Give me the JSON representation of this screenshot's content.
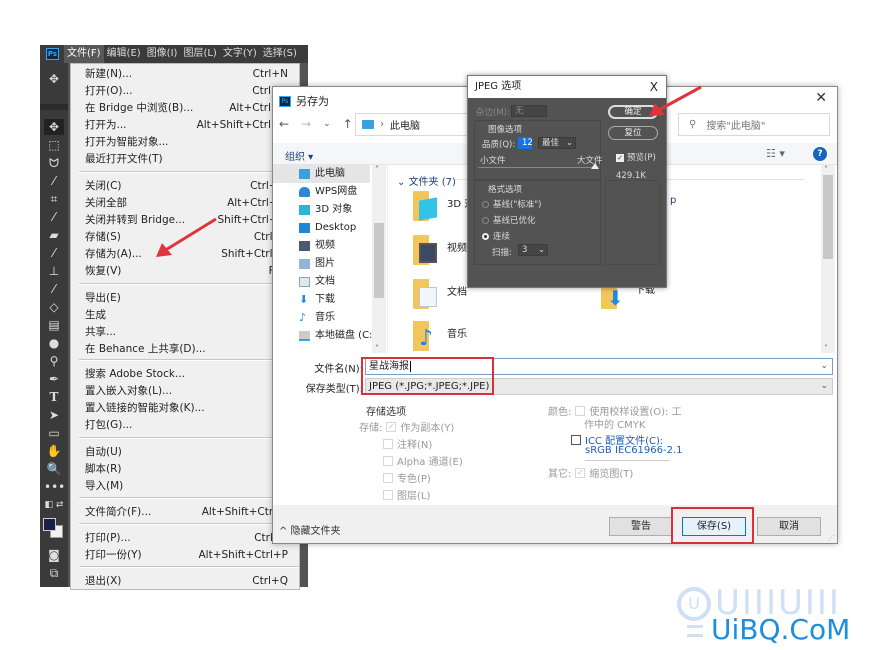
{
  "photoshop": {
    "menubar": [
      {
        "label": "文件(F)",
        "active": true
      },
      {
        "label": "编辑(E)"
      },
      {
        "label": "图像(I)"
      },
      {
        "label": "图层(L)"
      },
      {
        "label": "文字(Y)"
      },
      {
        "label": "选择(S)"
      }
    ],
    "logo": "Ps",
    "tools": [
      "move-tool",
      "marquee-tool",
      "lasso-tool",
      "magic-wand-tool",
      "crop-tool",
      "eyedropper-tool",
      "healing-brush-tool",
      "brush-tool",
      "clone-stamp-tool",
      "history-brush-tool",
      "eraser-tool",
      "gradient-tool",
      "blur-tool",
      "dodge-tool",
      "pen-tool",
      "type-tool",
      "path-selection-tool",
      "rectangle-tool",
      "hand-tool",
      "zoom-tool",
      "more-tools"
    ],
    "file_menu": [
      {
        "label": "新建(N)...",
        "shortcut": "Ctrl+N"
      },
      {
        "label": "打开(O)...",
        "shortcut": "Ctrl+O"
      },
      {
        "label": "在 Bridge 中浏览(B)...",
        "shortcut": "Alt+Ctrl+O"
      },
      {
        "label": "打开为...",
        "shortcut": "Alt+Shift+Ctrl+O"
      },
      {
        "label": "打开为智能对象...",
        "shortcut": ""
      },
      {
        "label": "最近打开文件(T)",
        "shortcut": ""
      },
      {
        "label": "关闭(C)",
        "shortcut": "Ctrl+W"
      },
      {
        "label": "关闭全部",
        "shortcut": "Alt+Ctrl+W"
      },
      {
        "label": "关闭并转到 Bridge...",
        "shortcut": "Shift+Ctrl+W"
      },
      {
        "label": "存储(S)",
        "shortcut": "Ctrl+S"
      },
      {
        "label": "存储为(A)...",
        "shortcut": "Shift+Ctrl+S"
      },
      {
        "label": "恢复(V)",
        "shortcut": "F12"
      },
      {
        "label": "导出(E)",
        "shortcut": ""
      },
      {
        "label": "生成",
        "shortcut": ""
      },
      {
        "label": "共享...",
        "shortcut": ""
      },
      {
        "label": "在 Behance 上共享(D)...",
        "shortcut": ""
      },
      {
        "label": "搜索 Adobe Stock...",
        "shortcut": ""
      },
      {
        "label": "置入嵌入对象(L)...",
        "shortcut": ""
      },
      {
        "label": "置入链接的智能对象(K)...",
        "shortcut": ""
      },
      {
        "label": "打包(G)...",
        "shortcut": ""
      },
      {
        "label": "自动(U)",
        "shortcut": ""
      },
      {
        "label": "脚本(R)",
        "shortcut": ""
      },
      {
        "label": "导入(M)",
        "shortcut": ""
      },
      {
        "label": "文件简介(F)...",
        "shortcut": "Alt+Shift+Ctrl+I"
      },
      {
        "label": "打印(P)...",
        "shortcut": "Ctrl+P"
      },
      {
        "label": "打印一份(Y)",
        "shortcut": "Alt+Shift+Ctrl+P"
      },
      {
        "label": "退出(X)",
        "shortcut": "Ctrl+Q"
      }
    ],
    "fg_color": "#1a1f4a",
    "bg_color": "#f2f2f2"
  },
  "save_as": {
    "title": "另存为",
    "close": "✕",
    "address": "此电脑",
    "search_placeholder": "搜索\"此电脑\"",
    "organize": "组织 ▾",
    "help": "?",
    "nav_items": [
      "此电脑",
      "WPS网盘",
      "3D 对象",
      "Desktop",
      "视频",
      "图片",
      "文档",
      "下载",
      "音乐",
      "本地磁盘 (C:)"
    ],
    "group_header": "文件夹 (7)",
    "folders": [
      "3D 对象",
      "视频",
      "文档",
      "音乐",
      "Desktop",
      "下载"
    ],
    "filename_label": "文件名(N):",
    "filename_value": "星战海报",
    "filetype_label": "保存类型(T):",
    "filetype_value": "JPEG (*.JPG;*.JPEG;*.JPE)",
    "options": {
      "header": "存储选项",
      "save_label": "存储:",
      "as_copy": "作为副本(Y)",
      "notes": "注释(N)",
      "alpha": "Alpha 通道(E)",
      "spot": "专色(P)",
      "layers": "图层(L)",
      "color_label": "颜色:",
      "proof": "使用校样设置(O): 工",
      "proof2": "作中的 CMYK",
      "icc": "ICC 配置文件(C):",
      "icc2": "sRGB IEC61966-2.1",
      "other_label": "其它:",
      "thumbnail": "缩览图(T)"
    },
    "hide_folders": "^ 隐藏文件夹",
    "buttons": {
      "warning": "警告",
      "save": "保存(S)",
      "cancel": "取消"
    }
  },
  "jpeg_options": {
    "title": "JPEG 选项",
    "close": "X",
    "matte_label": "杂边(M):",
    "matte_value": "无",
    "image_options": "图像选项",
    "quality_label": "品质(Q):",
    "quality_value": "12",
    "quality_preset": "最佳",
    "small_file": "小文件",
    "large_file": "大文件",
    "quality_fraction": 1.0,
    "format_options": "格式选项",
    "baseline_standard": "基线(\"标准\")",
    "baseline_optimized": "基线已优化",
    "progressive": "连续",
    "scans_label": "扫描:",
    "scans_value": "3",
    "ok": "确定",
    "reset": "复位",
    "preview": "预览(P)",
    "size": "429.1K"
  },
  "watermark": {
    "top": "UIIIUIII",
    "bottom": "UiBQ.CoM",
    "icon": "U"
  }
}
